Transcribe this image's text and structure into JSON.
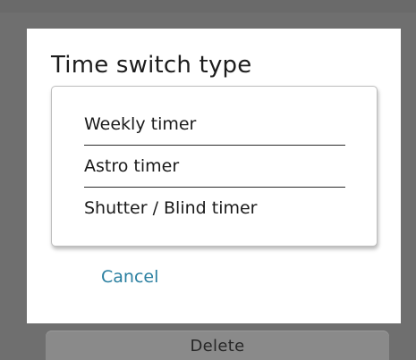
{
  "dialog": {
    "title": "Time switch type",
    "options": [
      {
        "label": "Weekly timer"
      },
      {
        "label": "Astro timer"
      },
      {
        "label": "Shutter / Blind timer"
      }
    ],
    "cancel_label": "Cancel"
  },
  "background": {
    "delete_label": "Delete"
  },
  "colors": {
    "accent": "#2a7fa0",
    "overlay": "#6f6f6f"
  }
}
